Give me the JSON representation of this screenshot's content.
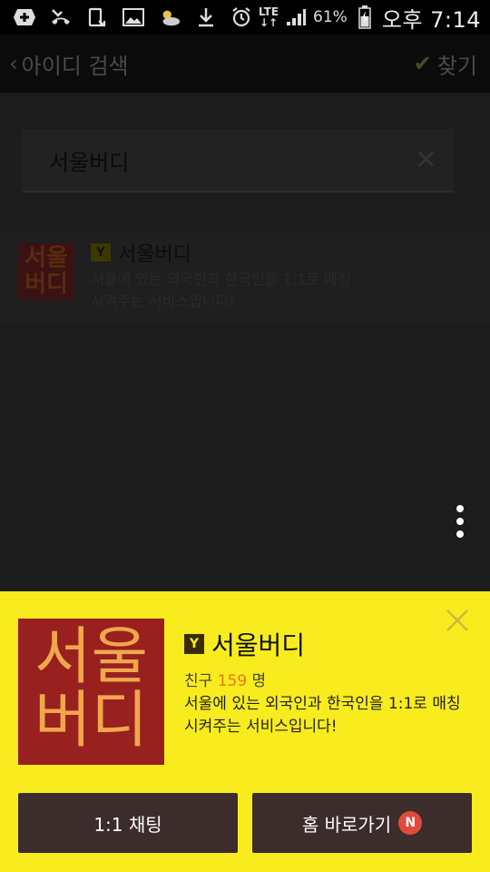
{
  "status_bar": {
    "battery": "61%",
    "network": "LTE",
    "time": "오후 7:14",
    "icons_left": [
      "add-icon",
      "missed-call-icon",
      "screen-rotate-icon",
      "image-icon",
      "weather-icon",
      "download-icon"
    ],
    "icons_right": [
      "alarm-icon",
      "lte-icon",
      "signal-icon",
      "battery-icon"
    ]
  },
  "app_bar": {
    "back_label": "아이디 검색",
    "find_label": "찾기"
  },
  "search": {
    "value": "서울버디"
  },
  "result": {
    "logo_text_line1": "서울",
    "logo_text_line2": "버디",
    "badge": "Y",
    "title": "서울버디",
    "description": "서울에 있는 외국인과 한국인을 1:1로 매칭시켜주는 서비스입니다!"
  },
  "profile_sheet": {
    "logo_text_line1": "서울",
    "logo_text_line2": "버디",
    "badge": "Y",
    "title": "서울버디",
    "friends_label": "친구",
    "friends_count": "159",
    "friends_unit": "명",
    "description": "서울에 있는 외국인과 한국인을 1:1로 매칭시켜주는 서비스입니다!",
    "chat_button": "1:1 채팅",
    "home_button": "홈 바로가기",
    "home_badge": "N"
  },
  "colors": {
    "sheet_bg": "#f9ec1e",
    "button_bg": "#3c2c2c",
    "logo_bg": "#98201f",
    "logo_text": "#f0a64b",
    "friends_count": "#e07a1a",
    "new_badge": "#e04b3c"
  }
}
